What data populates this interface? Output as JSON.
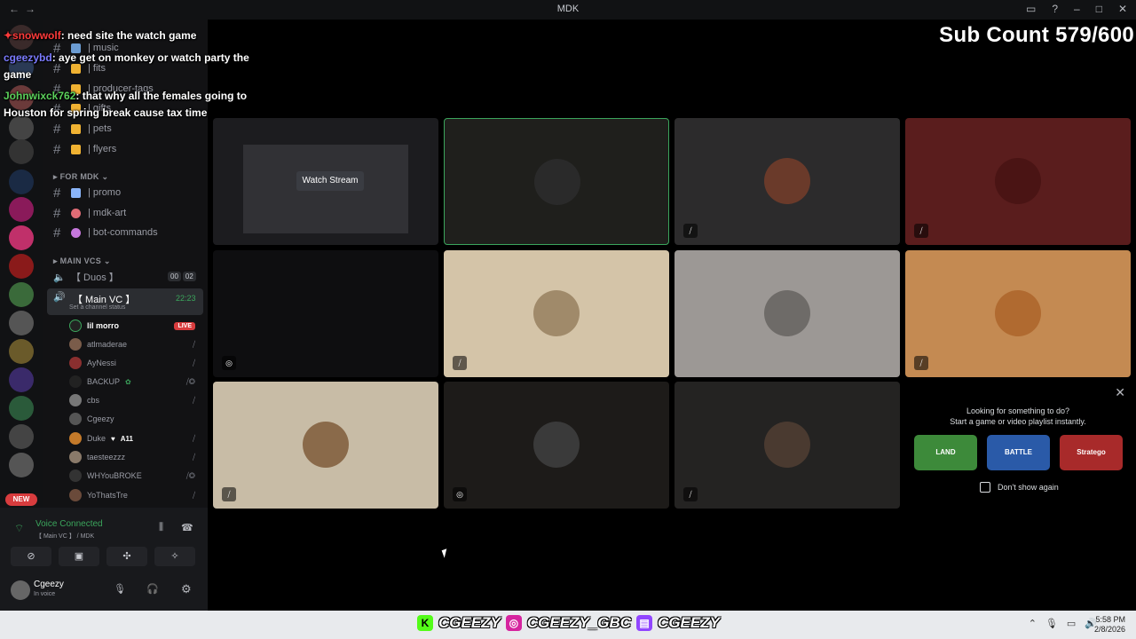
{
  "window": {
    "title": "MDK",
    "nav_back": "←",
    "nav_forward": "→"
  },
  "channels": {
    "top_items": [
      {
        "label": "| music",
        "emoji_color": "#6b9bd1"
      },
      {
        "label": "| fits",
        "emoji_color": "#f0b232"
      },
      {
        "label": "| producer-tags",
        "emoji_color": "#f0b232"
      },
      {
        "label": "| gifts",
        "emoji_color": "#f0b232"
      },
      {
        "label": "| pets",
        "emoji_color": "#f0b232"
      },
      {
        "label": "| flyers",
        "emoji_color": "#f0b232"
      }
    ],
    "for_mdk_category": "FOR MDK",
    "for_mdk_items": [
      {
        "label": "| promo",
        "emoji_color": "#8ab4f8"
      },
      {
        "label": "| mdk-art",
        "emoji_color": "#e06c75"
      },
      {
        "label": "| bot-commands",
        "emoji_color": "#c678dd"
      }
    ],
    "main_vcs_category": "MAIN VCS",
    "duos": {
      "label": "【 Duos 】",
      "count_a": "00",
      "count_b": "02"
    },
    "main_vc": {
      "label": "【 Main VC 】",
      "time": "22:23",
      "status": "Set a channel status"
    },
    "members": [
      {
        "name": "lil morro",
        "live": "LIVE",
        "avatar_color": "#222",
        "highlight": true
      },
      {
        "name": "atlmaderae",
        "avatar_color": "#7a5c4a"
      },
      {
        "name": "AyNessi",
        "avatar_color": "#8a2f2f"
      },
      {
        "name": "BACKUP",
        "avatar_color": "#222"
      },
      {
        "name": "cbs",
        "avatar_color": "#777"
      },
      {
        "name": "Cgeezy",
        "avatar_color": "#555"
      },
      {
        "name": "Duke",
        "suffix": "A11",
        "avatar_color": "#c47a2a"
      },
      {
        "name": "taesteezzz",
        "avatar_color": "#8a7a6a"
      },
      {
        "name": "WHYouBROKE",
        "avatar_color": "#333"
      },
      {
        "name": "YoThatsTre",
        "avatar_color": "#6a4a3a"
      }
    ]
  },
  "voice_panel": {
    "status": "Voice Connected",
    "channel": "【 Main VC 】 / MDK"
  },
  "user": {
    "name": "Cgeezy",
    "status": "In voice"
  },
  "grid": {
    "watch_stream_label": "Watch Stream"
  },
  "activity": {
    "close": "✕",
    "title_line1": "Looking for something to do?",
    "title_line2": "Start a game or video playlist instantly.",
    "games": [
      "LAND",
      "BATTLE",
      "Stratego"
    ],
    "dont_show": "Don't show again"
  },
  "overlay": {
    "sub_count": "Sub Count 579/600",
    "chat": [
      {
        "user": "✦snowwolf",
        "sep": ":",
        "msg": " need site the watch game"
      },
      {
        "user": "cgeezybd",
        "sep": ":",
        "msg": " aye get on monkey or watch party the game"
      },
      {
        "user": "Johnwixck762",
        "sep": ":",
        "msg": " that why all the females going to Houston for spring break cause tax time"
      }
    ]
  },
  "taskbar": {
    "handles": [
      "CGEEZY",
      "CGEEZY_GBC",
      "CGEEZY"
    ],
    "time": "5:58 PM",
    "date": "2/8/2026"
  },
  "colors": {
    "accent_green": "#3ba55c",
    "live_red": "#d83c3e",
    "speaking_border": "#3ba55c"
  }
}
